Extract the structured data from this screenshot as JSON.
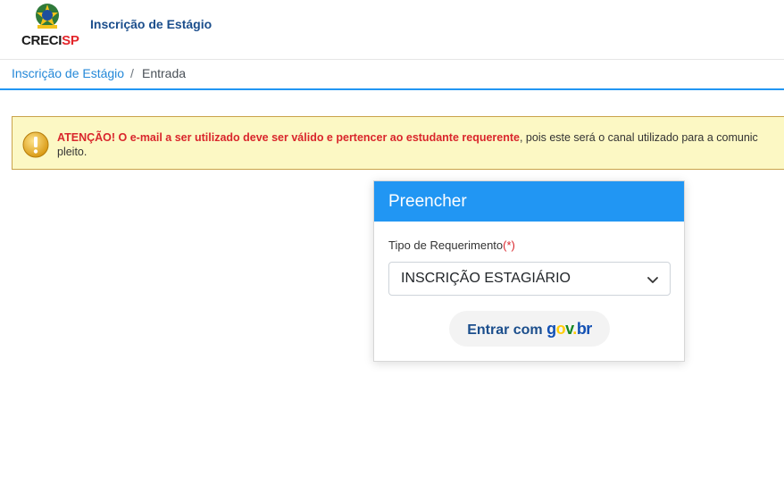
{
  "header": {
    "logo_text_main": "CRECI",
    "logo_text_accent": "SP",
    "app_title": "Inscrição de Estágio"
  },
  "breadcrumb": {
    "link": "Inscrição de Estágio",
    "separator": "/",
    "current": "Entrada"
  },
  "alert": {
    "strong_text": "ATENÇÃO! O e-mail a ser utilizado deve ser válido e pertencer ao estudante requerente",
    "normal_text": ", pois este será o canal utilizado para a comunic",
    "second_line": "pleito.",
    "icon": "warning-icon"
  },
  "card": {
    "title": "Preencher",
    "field_label": "Tipo de Requerimento",
    "required_mark": "(*)",
    "select_value": "INSCRIÇÃO ESTAGIÁRIO",
    "button_prefix": "Entrar com ",
    "govbr_g": "g",
    "govbr_o": "o",
    "govbr_v": "v",
    "govbr_dot": ".",
    "govbr_br": "br"
  },
  "colors": {
    "primary": "#2196f3",
    "title_blue": "#1b4e8c",
    "alert_bg": "#fcf8c4",
    "alert_red": "#d9262c"
  }
}
